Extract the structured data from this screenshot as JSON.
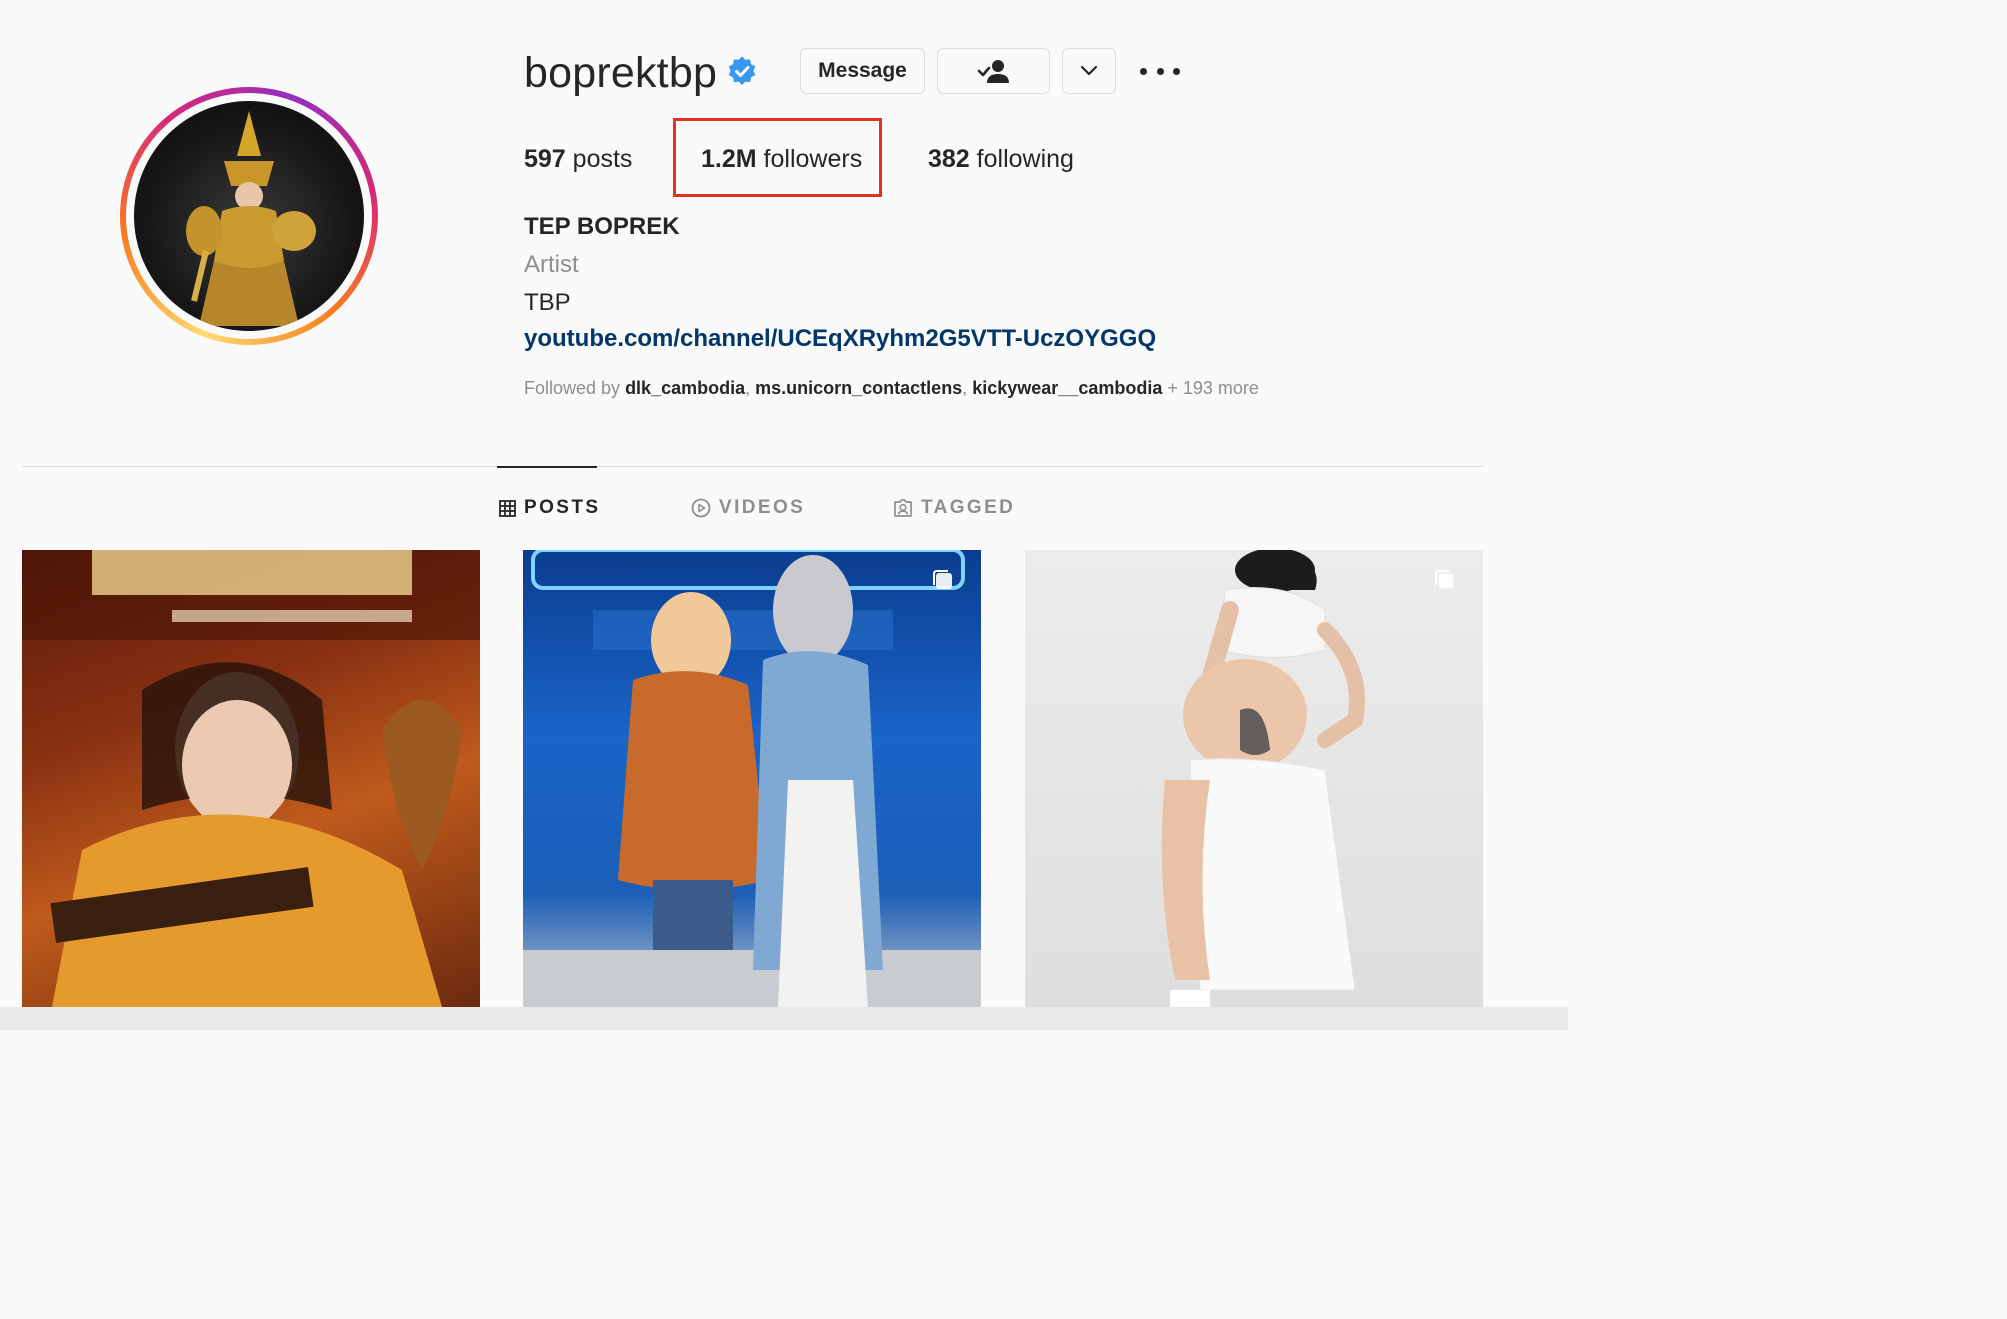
{
  "profile": {
    "username": "boprektbp",
    "verified": true,
    "avatar_icon": "profile-photo",
    "buttons": {
      "message": "Message",
      "following_icon": "person-check-icon",
      "dropdown_icon": "chevron-down-icon",
      "more_icon": "more-horizontal-icon"
    },
    "stats": {
      "posts_count": "597",
      "posts_label": "posts",
      "followers_count": "1.2M",
      "followers_label": "followers",
      "following_count": "382",
      "following_label": "following"
    },
    "bio": {
      "full_name": "TEP BOPREK",
      "category": "Artist",
      "text": "TBP",
      "link": "youtube.com/channel/UCEqXRyhm2G5VTT-UczOYGGQ"
    },
    "followed_by": {
      "prefix": "Followed by",
      "users": [
        "dlk_cambodia",
        "ms.unicorn_contactlens",
        "kickywear__cambodia"
      ],
      "suffix": "+ 193 more"
    }
  },
  "tabs": [
    {
      "label": "POSTS",
      "icon": "grid-icon",
      "active": true
    },
    {
      "label": "VIDEOS",
      "icon": "play-circle-icon",
      "active": false
    },
    {
      "label": "TAGGED",
      "icon": "tag-person-icon",
      "active": false
    }
  ],
  "posts": [
    {
      "name": "post-1",
      "multi": false
    },
    {
      "name": "post-2",
      "multi": true
    },
    {
      "name": "post-3",
      "multi": true
    }
  ],
  "colors": {
    "highlight": "#e0301e",
    "verified": "#3897f0",
    "link": "#00376b"
  }
}
